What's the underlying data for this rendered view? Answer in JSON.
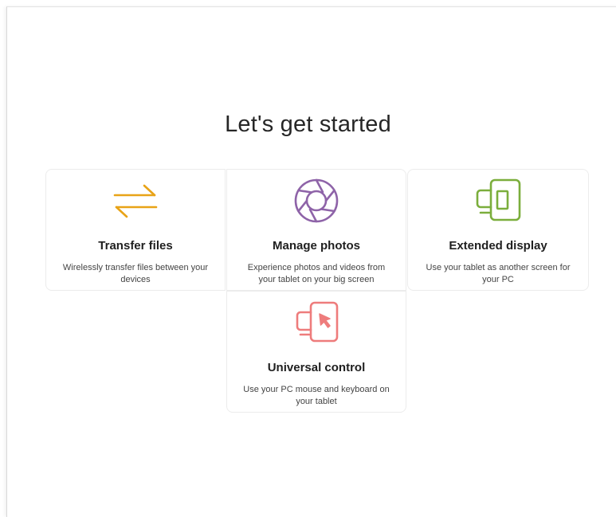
{
  "page": {
    "title": "Let's get started"
  },
  "cards": [
    {
      "id": "transfer",
      "icon": "transfer-arrows-icon",
      "title": "Transfer files",
      "description": "Wirelessly transfer files between your devices",
      "color": "#E8A317"
    },
    {
      "id": "photos",
      "icon": "aperture-icon",
      "title": "Manage photos",
      "description": "Experience photos and videos from your tablet on your big screen",
      "color": "#8E63A8"
    },
    {
      "id": "extended",
      "icon": "extended-display-icon",
      "title": "Extended display",
      "description": "Use your tablet as another screen for your PC",
      "color": "#7BAE3C"
    },
    {
      "id": "universal",
      "icon": "universal-control-icon",
      "title": "Universal control",
      "description": "Use your PC mouse and keyboard on your tablet",
      "color": "#EE7C7C"
    }
  ]
}
